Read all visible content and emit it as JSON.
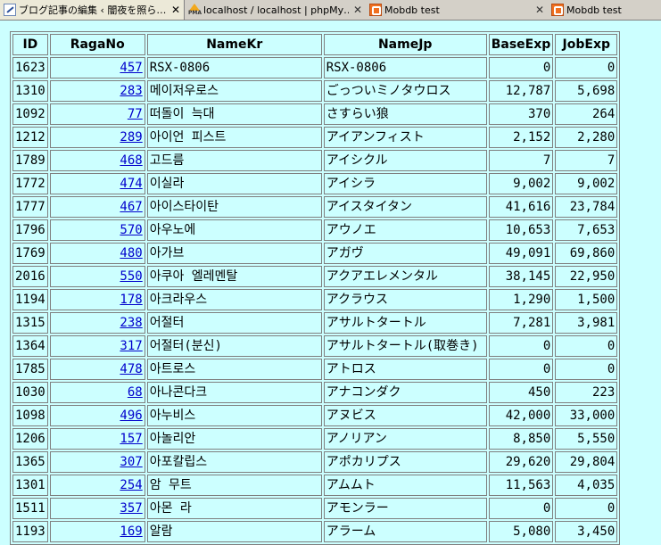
{
  "tabs": [
    {
      "label": "ブログ記事の編集 ‹ 闇夜を照ら…",
      "icon": "wrench-icon",
      "active": true
    },
    {
      "label": "localhost / localhost | phpMy…",
      "icon": "phpmyadmin-icon",
      "active": false
    },
    {
      "label": "Mobdb test",
      "icon": "mobdb-icon",
      "active": false
    },
    {
      "label": "Mobdb test",
      "icon": "mobdb-icon",
      "active": false
    }
  ],
  "table": {
    "columns": [
      "ID",
      "RagaNo",
      "NameKr",
      "NameJp",
      "BaseExp",
      "JobExp"
    ],
    "rows": [
      {
        "id": "1623",
        "raga": "457",
        "kr": "RSX-0806",
        "jp": "RSX-0806",
        "base": "0",
        "job": "0"
      },
      {
        "id": "1310",
        "raga": "283",
        "kr": "메이저우로스",
        "jp": "ごっついミノタウロス",
        "base": "12,787",
        "job": "5,698"
      },
      {
        "id": "1092",
        "raga": "77",
        "kr": "떠돌이 늑대",
        "jp": "さすらい狼",
        "base": "370",
        "job": "264"
      },
      {
        "id": "1212",
        "raga": "289",
        "kr": "아이언 피스트",
        "jp": "アイアンフィスト",
        "base": "2,152",
        "job": "2,280"
      },
      {
        "id": "1789",
        "raga": "468",
        "kr": "고드름",
        "jp": "アイシクル",
        "base": "7",
        "job": "7"
      },
      {
        "id": "1772",
        "raga": "474",
        "kr": "이실라",
        "jp": "アイシラ",
        "base": "9,002",
        "job": "9,002"
      },
      {
        "id": "1777",
        "raga": "467",
        "kr": "아이스타이탄",
        "jp": "アイスタイタン",
        "base": "41,616",
        "job": "23,784"
      },
      {
        "id": "1796",
        "raga": "570",
        "kr": "아우노에",
        "jp": "アウノエ",
        "base": "10,653",
        "job": "7,653"
      },
      {
        "id": "1769",
        "raga": "480",
        "kr": "아가브",
        "jp": "アガヴ",
        "base": "49,091",
        "job": "69,860"
      },
      {
        "id": "2016",
        "raga": "550",
        "kr": "아쿠아 엘레멘탈",
        "jp": "アクアエレメンタル",
        "base": "38,145",
        "job": "22,950"
      },
      {
        "id": "1194",
        "raga": "178",
        "kr": "아크라우스",
        "jp": "アクラウス",
        "base": "1,290",
        "job": "1,500"
      },
      {
        "id": "1315",
        "raga": "238",
        "kr": "어절터",
        "jp": "アサルトタートル",
        "base": "7,281",
        "job": "3,981"
      },
      {
        "id": "1364",
        "raga": "317",
        "kr": "어절터(분신)",
        "jp": "アサルトタートル(取巻き)",
        "base": "0",
        "job": "0"
      },
      {
        "id": "1785",
        "raga": "478",
        "kr": "아트로스",
        "jp": "アトロス",
        "base": "0",
        "job": "0"
      },
      {
        "id": "1030",
        "raga": "68",
        "kr": "아나콘다크",
        "jp": "アナコンダク",
        "base": "450",
        "job": "223"
      },
      {
        "id": "1098",
        "raga": "496",
        "kr": "아누비스",
        "jp": "アヌビス",
        "base": "42,000",
        "job": "33,000"
      },
      {
        "id": "1206",
        "raga": "157",
        "kr": "아놀리안",
        "jp": "アノリアン",
        "base": "8,850",
        "job": "5,550"
      },
      {
        "id": "1365",
        "raga": "307",
        "kr": "아포칼립스",
        "jp": "アポカリプス",
        "base": "29,620",
        "job": "29,804"
      },
      {
        "id": "1301",
        "raga": "254",
        "kr": "암 무트",
        "jp": "アムムト",
        "base": "11,563",
        "job": "4,035"
      },
      {
        "id": "1511",
        "raga": "357",
        "kr": "아몬 라",
        "jp": "アモンラー",
        "base": "0",
        "job": "0"
      },
      {
        "id": "1193",
        "raga": "169",
        "kr": "알람",
        "jp": "アラーム",
        "base": "5,080",
        "job": "3,450"
      }
    ]
  }
}
